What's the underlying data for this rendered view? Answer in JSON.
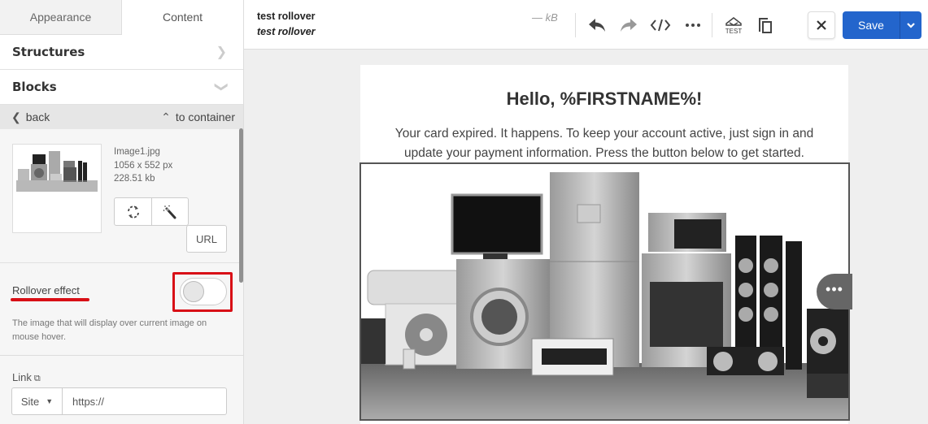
{
  "sidebar": {
    "tabs": [
      {
        "label": "Appearance",
        "active": false
      },
      {
        "label": "Content",
        "active": true
      }
    ],
    "sections": {
      "structures": "Structures",
      "blocks": "Blocks"
    },
    "nav": {
      "back": "back",
      "to_container": "to container"
    },
    "image": {
      "filename": "Image1.jpg",
      "dimensions": "1056 x 552 px",
      "filesize": "228.51 kb",
      "replace_icon": "refresh-icon",
      "edit_icon": "magic-wand-icon",
      "url_label": "URL"
    },
    "rollover": {
      "label": "Rollover effect",
      "enabled": false,
      "description": "The image that will display over current image on mouse hover."
    },
    "link": {
      "label": "Link",
      "type": "Site",
      "value": "https://"
    }
  },
  "topbar": {
    "title": "test rollover",
    "subtitle": "test rollover",
    "size": "— kB",
    "icons": [
      "undo-icon",
      "redo-icon",
      "code-icon",
      "more-icon",
      "test-email-icon",
      "copy-icon"
    ],
    "test_label": "TEST",
    "save_label": "Save"
  },
  "email": {
    "greeting": "Hello, %FIRSTNAME%!",
    "body": "Your card expired. It happens. To keep your account active, just sign in and update your payment information. Press the button below to get started.",
    "image_alt": "Home appliances and electronics"
  },
  "colors": {
    "accent": "#2365cc",
    "highlight": "#d80f16"
  }
}
